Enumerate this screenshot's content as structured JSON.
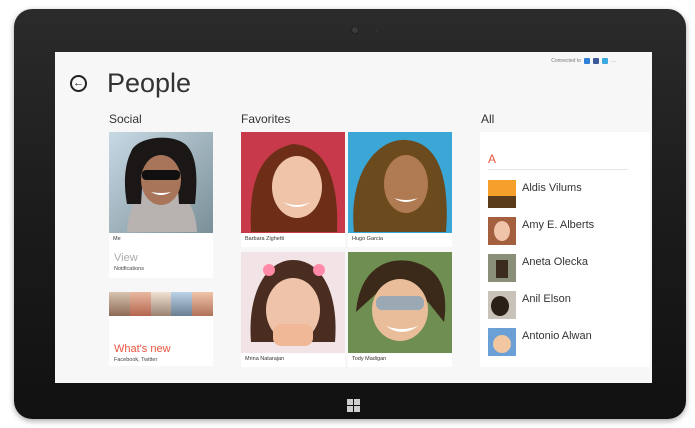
{
  "header": {
    "connected_label": "Connected to",
    "title": "People"
  },
  "sections": {
    "social": "Social",
    "favorites": "Favorites",
    "all": "All"
  },
  "social": {
    "me_caption": "Me",
    "view_label": "View",
    "view_sub": "Notifications",
    "whatsnew_label": "What's new",
    "whatsnew_sub": "Facebook, Twitter"
  },
  "favorites": [
    {
      "name": "Barbara Zighetti"
    },
    {
      "name": "Hugo Garcia"
    },
    {
      "name": "Mrina Natarajan"
    },
    {
      "name": "Tody Madigan"
    }
  ],
  "all": {
    "letter": "A",
    "contacts": [
      {
        "name": "Aldis Vilums"
      },
      {
        "name": "Amy E. Alberts"
      },
      {
        "name": "Aneta Olecka"
      },
      {
        "name": "Anil Elson"
      },
      {
        "name": "Antonio Alwan"
      }
    ]
  },
  "colors": {
    "accent": "#e8563f",
    "social_bar": "#7bb735",
    "service_1": "#2f7ed8",
    "service_2": "#3b5998",
    "service_3": "#3aa9e0"
  }
}
